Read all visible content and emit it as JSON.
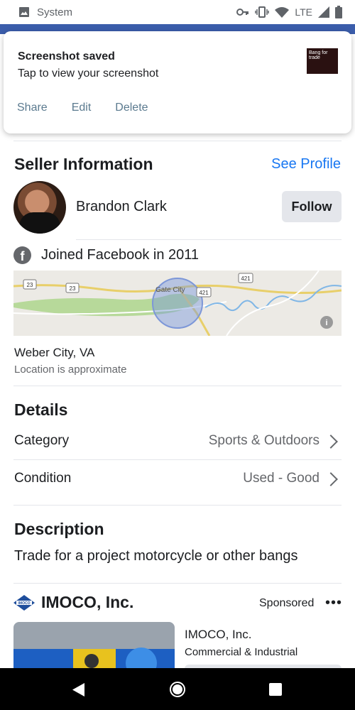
{
  "status_bar": {
    "app_label": "System",
    "network": "LTE",
    "icons": [
      "image-icon",
      "key-icon",
      "vibrate-icon",
      "wifi-icon",
      "signal-icon",
      "battery-icon"
    ]
  },
  "notification": {
    "title": "Screenshot saved",
    "subtitle": "Tap to view your screenshot",
    "actions": [
      "Share",
      "Edit",
      "Delete"
    ],
    "thumbnail_text": "Bang for trade"
  },
  "seller": {
    "heading": "Seller Information",
    "see_profile": "See Profile",
    "name": "Brandon Clark",
    "follow": "Follow",
    "joined": "Joined Facebook in 2011"
  },
  "map": {
    "place_label": "Gate City",
    "road_labels": [
      "23",
      "23",
      "421",
      "421"
    ]
  },
  "location": {
    "city": "Weber City, VA",
    "note": "Location is approximate"
  },
  "details": {
    "heading": "Details",
    "rows": [
      {
        "label": "Category",
        "value": "Sports & Outdoors"
      },
      {
        "label": "Condition",
        "value": "Used - Good"
      }
    ]
  },
  "description": {
    "heading": "Description",
    "text": "Trade for a project motorcycle or other bangs"
  },
  "ad": {
    "advertiser": "IMOCO, Inc.",
    "sponsored": "Sponsored",
    "more": "•••",
    "logo_text": "IMOCO",
    "title": "IMOCO, Inc.",
    "subtitle": "Commercial & Industrial"
  },
  "colors": {
    "accent": "#1877f2",
    "header_blue": "#3b5dab"
  }
}
